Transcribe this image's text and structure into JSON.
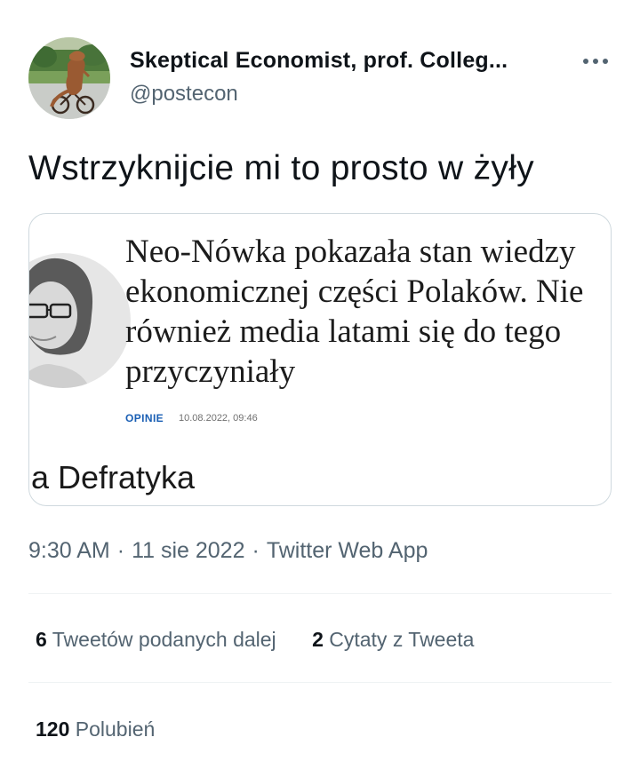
{
  "author": {
    "name": "Skeptical Economist, prof. Colleg...",
    "handle": "@postecon"
  },
  "tweet": {
    "text": "Wstrzyknijcie mi to prosto w żyły"
  },
  "media": {
    "headline": "Neo-Nówka pokazała stan wiedzy\nekonomicznej części Polaków. Nie\nrównież media latami się do tego\nprzyczyniały",
    "section": "OPINIE",
    "date": "10.08.2022, 09:46",
    "author_fragment": "a Defratyka"
  },
  "meta": {
    "time": "9:30 AM",
    "date": "11 sie 2022",
    "source": "Twitter Web App",
    "separator": "·"
  },
  "stats": {
    "retweets_count": "6",
    "retweets_label": "Tweetów podanych dalej",
    "quotes_count": "2",
    "quotes_label": "Cytaty z Tweeta",
    "likes_count": "120",
    "likes_label": "Polubień"
  },
  "icons": {
    "more": "more-dots-icon"
  },
  "colors": {
    "text_primary": "#0f1419",
    "text_secondary": "#536471",
    "border": "#cfd9de",
    "divider": "#eff3f4",
    "section_blue": "#1a5fb4"
  }
}
